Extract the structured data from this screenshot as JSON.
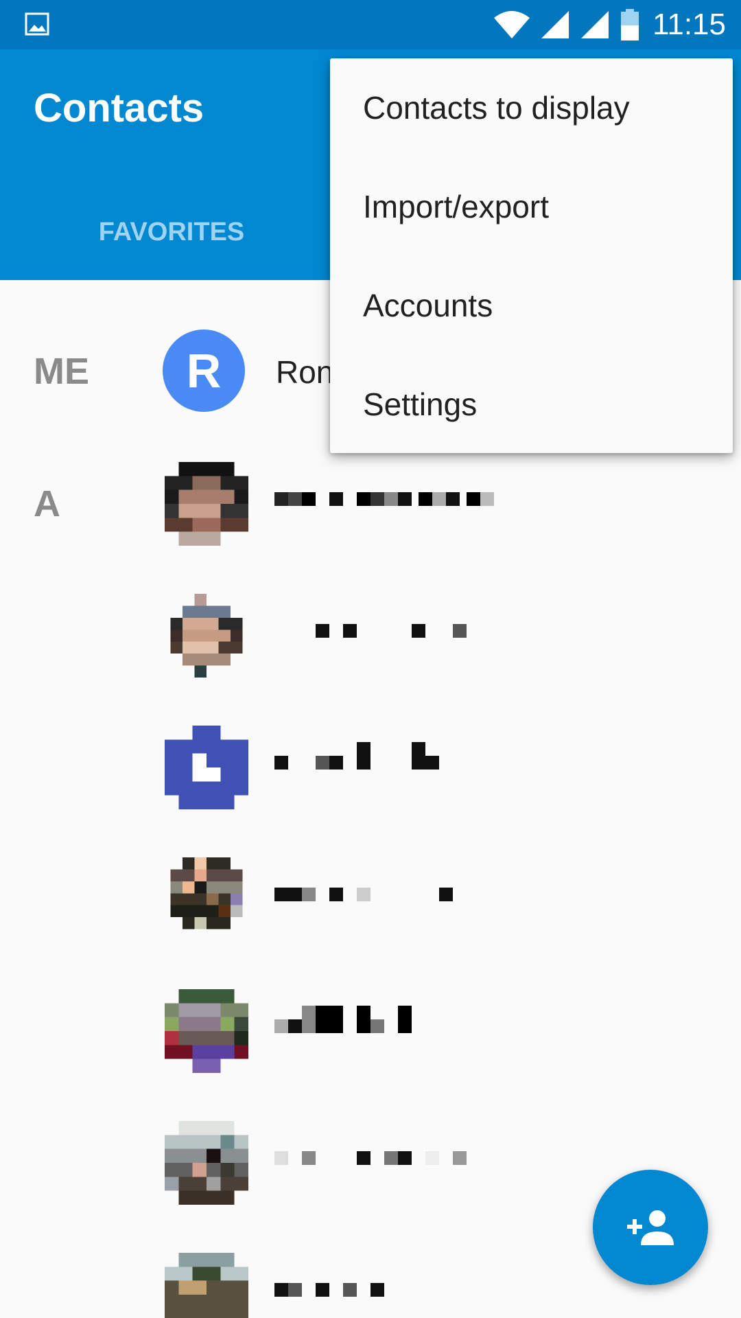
{
  "status_bar": {
    "time": "11:15",
    "left_icon": "image-notification-icon",
    "icons": [
      "wifi-icon",
      "cell-signal-icon",
      "cell-signal-icon",
      "battery-icon"
    ]
  },
  "app_bar": {
    "title": "Contacts",
    "tabs": [
      {
        "label": "FAVORITES"
      }
    ]
  },
  "list": {
    "me_section_label": "ME",
    "me_avatar_initial": "R",
    "me_name": "Ron",
    "a_section_label": "A"
  },
  "menu": {
    "items": [
      {
        "label": "Contacts to display"
      },
      {
        "label": "Import/export"
      },
      {
        "label": "Accounts"
      },
      {
        "label": "Settings"
      }
    ]
  },
  "fab": {
    "icon": "add-person-icon"
  },
  "colors": {
    "status_bar": "#0277bd",
    "app_bar": "#0288d1",
    "accent_avatar": "#4a8af4",
    "tab_inactive": "#9fd3f2"
  }
}
